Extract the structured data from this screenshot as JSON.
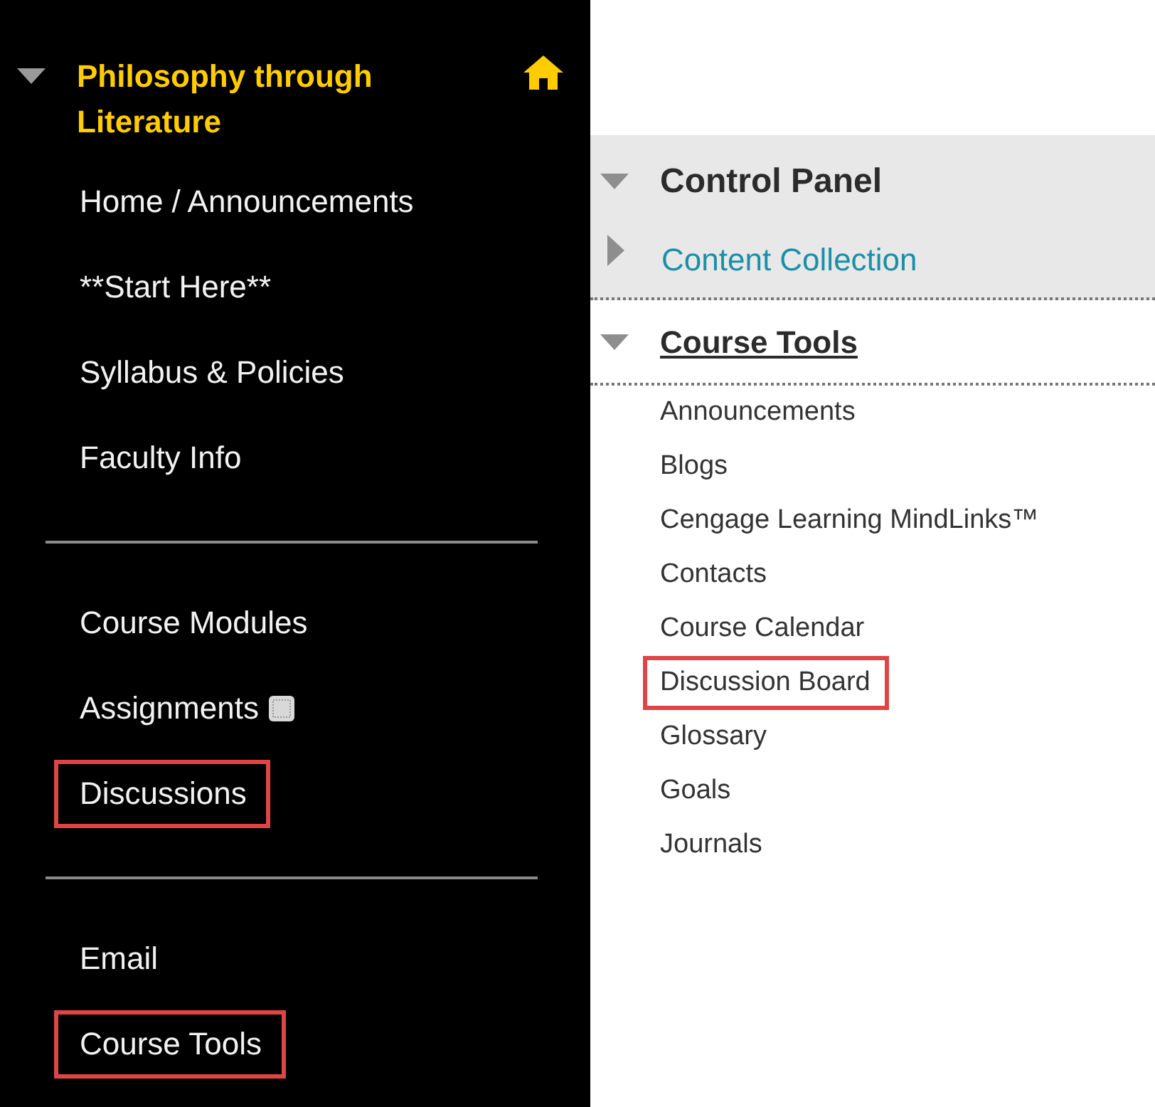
{
  "course_menu": {
    "title": "Philosophy through Literature",
    "expanded": true,
    "groups": [
      {
        "items": [
          {
            "label": "Home / Announcements",
            "highlighted": false,
            "marked": false
          },
          {
            "label": "**Start Here**",
            "highlighted": false,
            "marked": false
          },
          {
            "label": "Syllabus & Policies",
            "highlighted": false,
            "marked": false
          },
          {
            "label": "Faculty Info",
            "highlighted": false,
            "marked": false
          }
        ]
      },
      {
        "items": [
          {
            "label": "Course Modules",
            "highlighted": false,
            "marked": false
          },
          {
            "label": "Assignments",
            "highlighted": false,
            "marked": true
          },
          {
            "label": "Discussions",
            "highlighted": true,
            "marked": false
          }
        ]
      },
      {
        "items": [
          {
            "label": "Email",
            "highlighted": false,
            "marked": false
          },
          {
            "label": "Course Tools",
            "highlighted": true,
            "marked": false
          }
        ]
      }
    ]
  },
  "control_panel": {
    "title": "Control Panel",
    "expanded": true,
    "sections": [
      {
        "label": "Content Collection",
        "expanded": false
      }
    ]
  },
  "course_tools": {
    "title": "Course Tools",
    "expanded": true,
    "items": [
      {
        "label": "Announcements",
        "highlighted": false
      },
      {
        "label": "Blogs",
        "highlighted": false
      },
      {
        "label": "Cengage Learning MindLinks™",
        "highlighted": false
      },
      {
        "label": "Contacts",
        "highlighted": false
      },
      {
        "label": "Course Calendar",
        "highlighted": false
      },
      {
        "label": "Discussion Board",
        "highlighted": true
      },
      {
        "label": "Glossary",
        "highlighted": false
      },
      {
        "label": "Goals",
        "highlighted": false
      },
      {
        "label": "Journals",
        "highlighted": false
      }
    ]
  }
}
